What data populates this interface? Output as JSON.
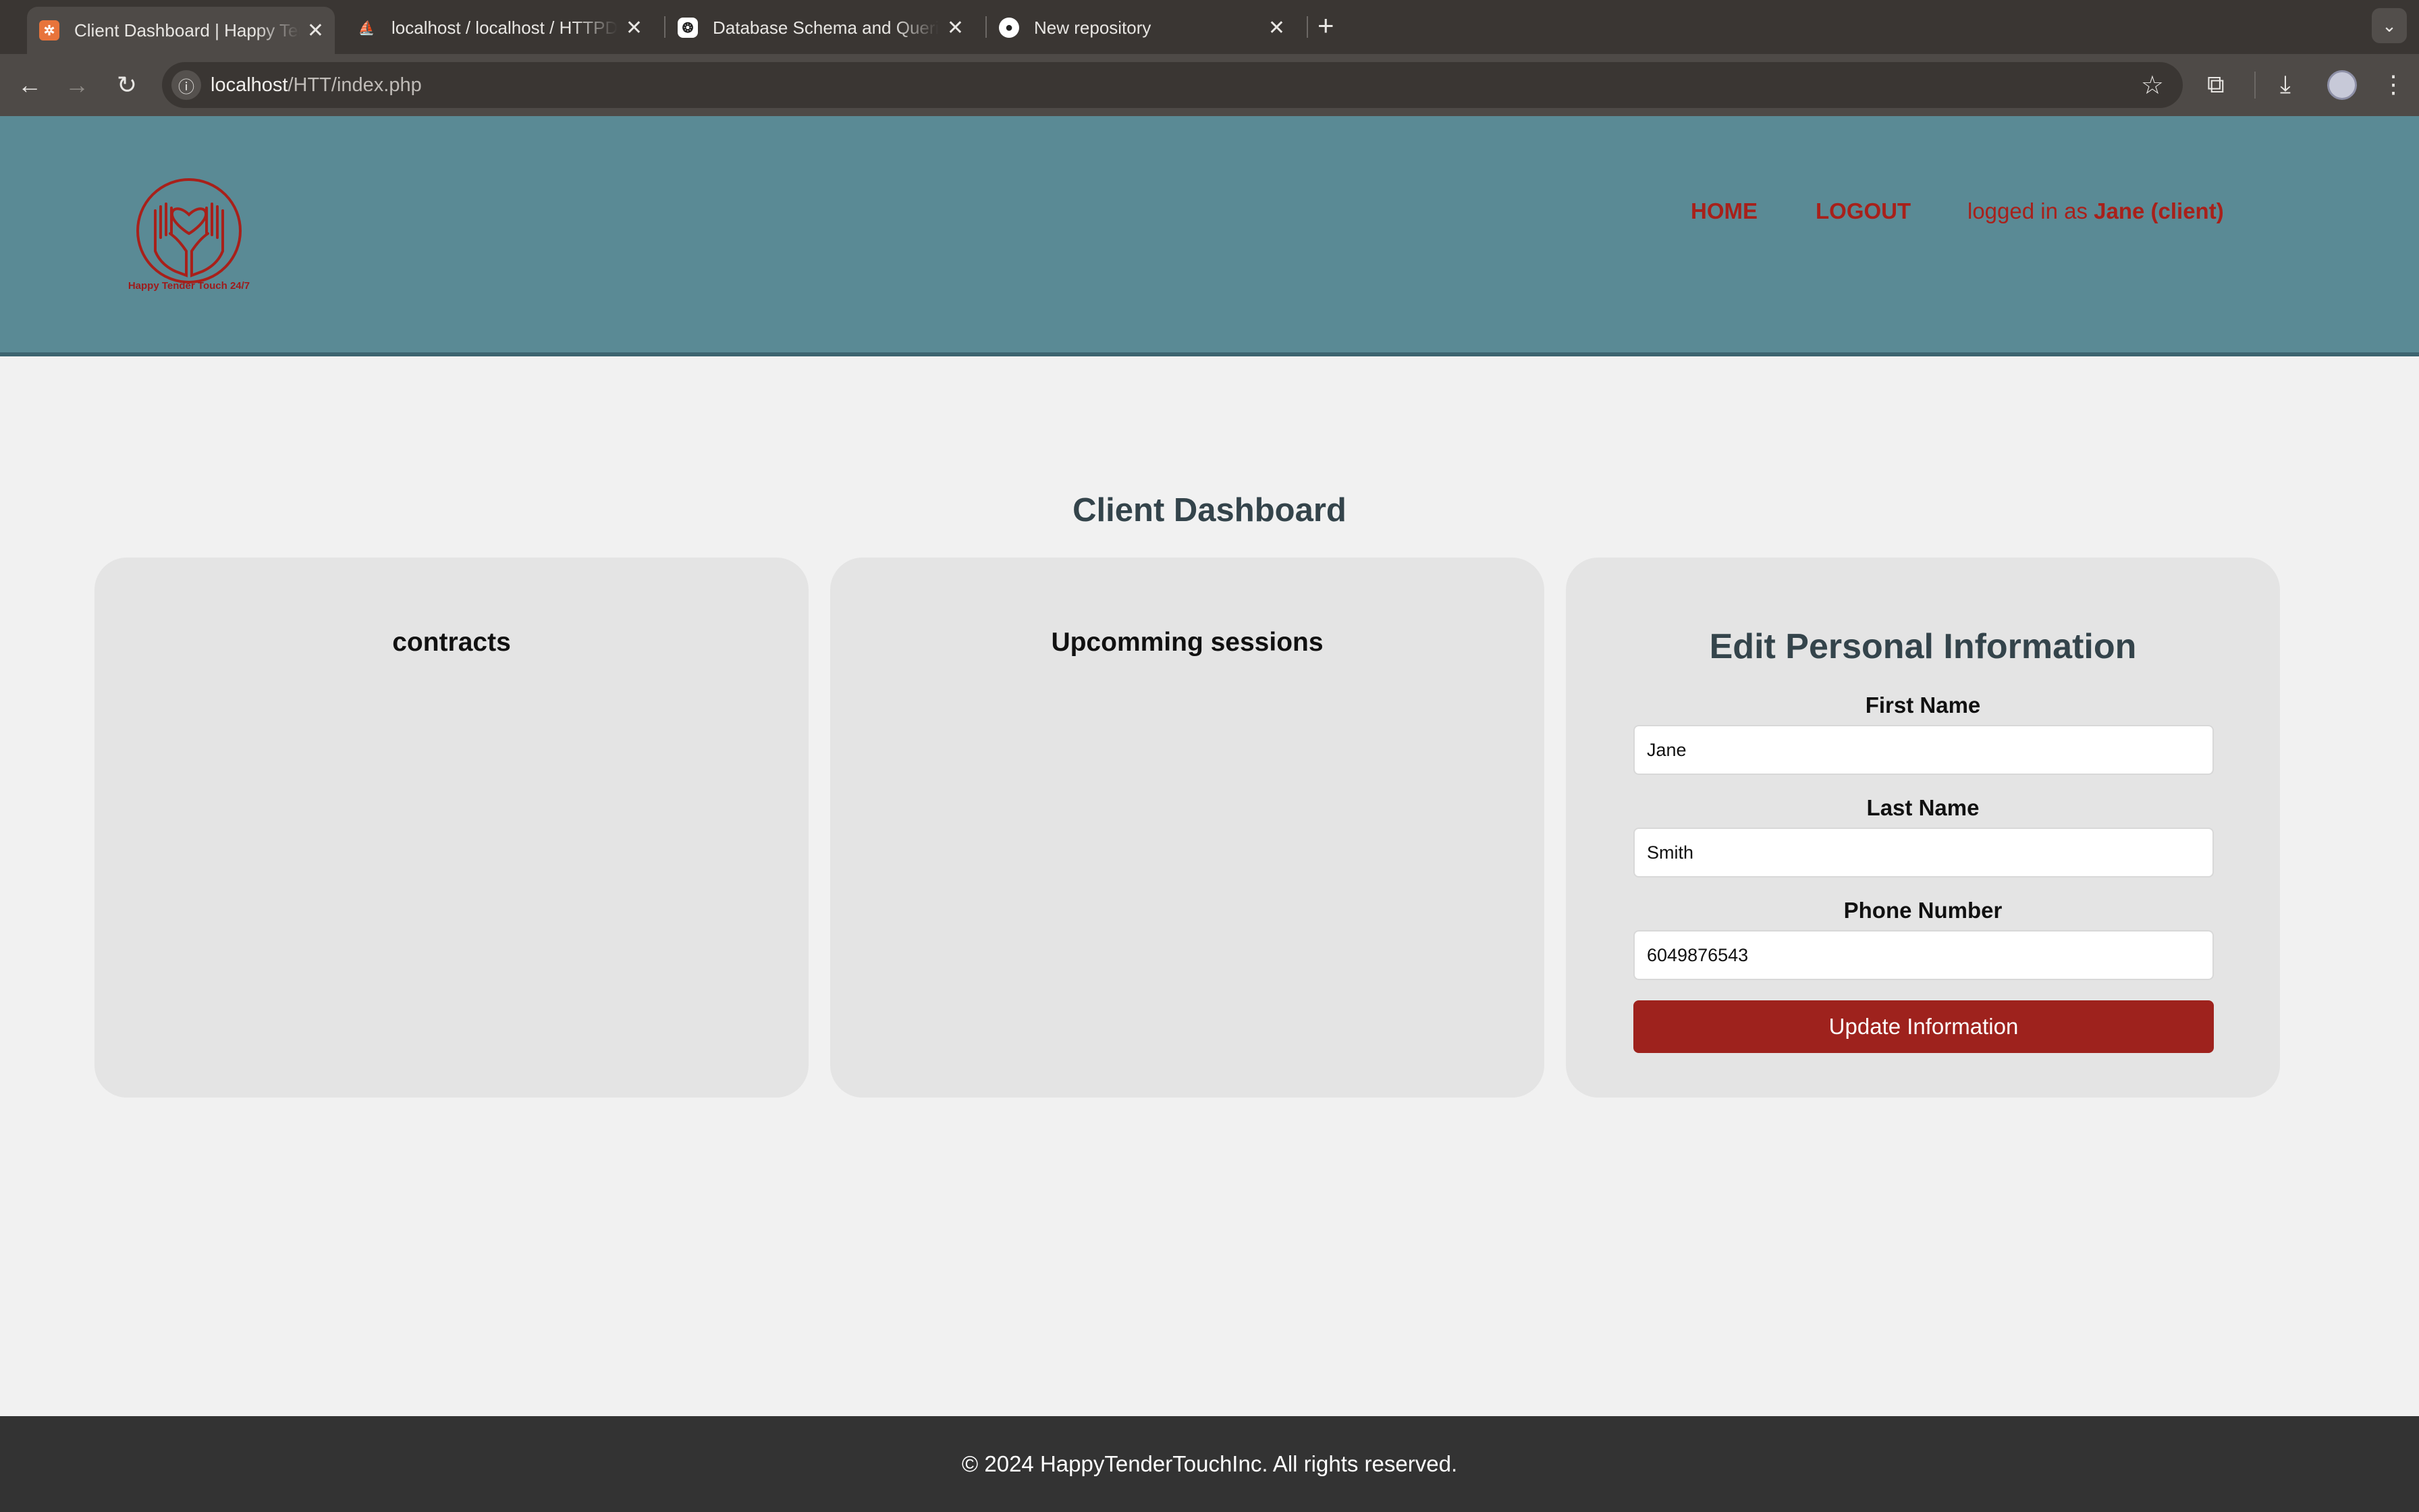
{
  "browser": {
    "tabs": [
      {
        "title": "Client Dashboard | Happy Tender Touch",
        "active": true,
        "favicon": "xampp-icon"
      },
      {
        "title": "localhost / localhost / HTTPDB | phpMyAdmin",
        "active": false,
        "favicon": "phpmyadmin-icon"
      },
      {
        "title": "Database Schema and Queries",
        "active": false,
        "favicon": "openai-icon"
      },
      {
        "title": "New repository",
        "active": false,
        "favicon": "github-icon"
      }
    ],
    "url_host": "localhost",
    "url_path": "/HTT/index.php"
  },
  "site": {
    "logo_text": "Happy Tender Touch 24/7",
    "nav": {
      "home": "HOME",
      "logout": "LOGOUT"
    },
    "login_prefix": "logged in as ",
    "login_user": "Jane (client)"
  },
  "main": {
    "title": "Client Dashboard",
    "contracts_title": "contracts",
    "sessions_title": "Upcomming sessions",
    "form": {
      "title": "Edit Personal Information",
      "first_name_label": "First Name",
      "first_name_value": "Jane",
      "last_name_label": "Last Name",
      "last_name_value": "Smith",
      "phone_label": "Phone Number",
      "phone_value": "6049876543",
      "submit_label": "Update Information"
    }
  },
  "footer": {
    "text": "© 2024 HappyTenderTouchInc. All rights reserved."
  },
  "colors": {
    "header_bg": "#5a8a95",
    "accent": "#9e221d",
    "footer_bg": "#333333"
  }
}
